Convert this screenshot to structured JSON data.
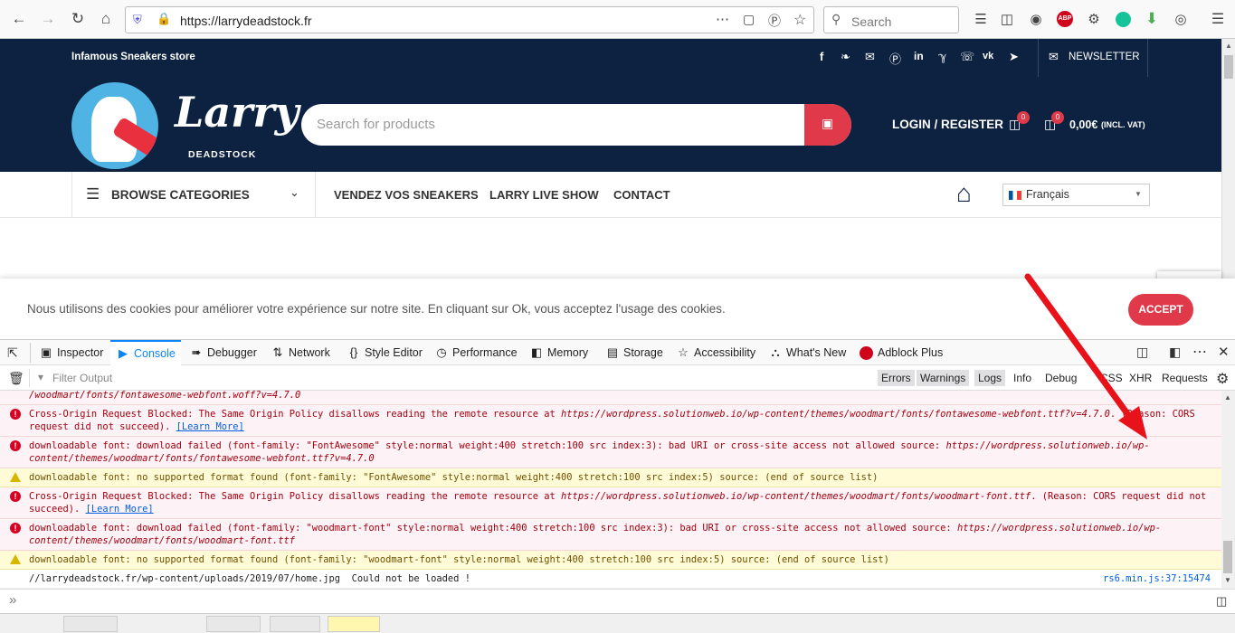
{
  "browser": {
    "url": "https://larrydeadstock.fr",
    "search_placeholder": "Search",
    "abp_badge": "ABP"
  },
  "site": {
    "tagline": "Infamous Sneakers store",
    "newsletter_label": "NEWSLETTER",
    "logo_script": "Larry",
    "logo_sub": "DEADSTOCK",
    "search_placeholder": "Search for products",
    "login_label": "LOGIN / REGISTER",
    "wishlist_count": "0",
    "cart_count": "0",
    "cart_total": "0,00€",
    "cart_vat": "(INCL. VAT)",
    "browse_label": "BROWSE CATEGORIES",
    "nav_items": [
      {
        "label": "VENDEZ VOS SNEAKERS"
      },
      {
        "label": "LARRY LIVE SHOW"
      },
      {
        "label": "CONTACT"
      }
    ],
    "language": "Français",
    "cookie_text": "Nous utilisons des cookies pour améliorer votre expérience sur notre site. En cliquant sur Ok, vous acceptez l'usage des cookies.",
    "accept_label": "ACCEPT"
  },
  "devtools": {
    "tabs": [
      {
        "label": "Inspector",
        "icon": "inspector-icon"
      },
      {
        "label": "Console",
        "icon": "console-icon"
      },
      {
        "label": "Debugger",
        "icon": "debugger-icon"
      },
      {
        "label": "Network",
        "icon": "network-icon"
      },
      {
        "label": "Style Editor",
        "icon": "style-editor-icon"
      },
      {
        "label": "Performance",
        "icon": "performance-icon"
      },
      {
        "label": "Memory",
        "icon": "memory-icon"
      },
      {
        "label": "Storage",
        "icon": "storage-icon"
      },
      {
        "label": "Accessibility",
        "icon": "accessibility-icon"
      },
      {
        "label": "What's New",
        "icon": "whats-new-icon"
      },
      {
        "label": "Adblock Plus",
        "icon": "abp-icon"
      }
    ],
    "filter_placeholder": "Filter Output",
    "filters": [
      {
        "label": "Errors",
        "on": true
      },
      {
        "label": "Warnings",
        "on": true
      },
      {
        "label": "Logs",
        "on": true
      },
      {
        "label": "Info",
        "on": false
      },
      {
        "label": "Debug",
        "on": false
      },
      {
        "label": "CSS",
        "on": false
      },
      {
        "label": "XHR",
        "on": false
      },
      {
        "label": "Requests",
        "on": false
      }
    ],
    "messages": [
      {
        "type": "err",
        "noicon": true,
        "text": "",
        "url": "/woodmart/fonts/fontawesome-webfont.woff?v=4.7.0",
        "after": "",
        "learn": ""
      },
      {
        "type": "err",
        "text": "Cross-Origin Request Blocked: The Same Origin Policy disallows reading the remote resource at ",
        "url": "https://wordpress.solutionweb.io/wp-content/themes/woodmart/fonts/fontawesome-webfont.ttf?v=4.7.0",
        "after": ". (Reason: CORS request did not succeed). ",
        "learn": "[Learn More]"
      },
      {
        "type": "err",
        "text": "downloadable font: download failed (font-family: \"FontAwesome\" style:normal weight:400 stretch:100 src index:3): bad URI or cross-site access not allowed source: ",
        "url": "https://wordpress.solutionweb.io/wp-content/themes/woodmart/fonts/fontawesome-webfont.ttf?v=4.7.0",
        "after": "",
        "learn": ""
      },
      {
        "type": "warn",
        "text": "downloadable font: no supported format found (font-family: \"FontAwesome\" style:normal weight:400 stretch:100 src index:5) source: (end of source list)",
        "url": "",
        "after": "",
        "learn": ""
      },
      {
        "type": "err",
        "text": "Cross-Origin Request Blocked: The Same Origin Policy disallows reading the remote resource at ",
        "url": "https://wordpress.solutionweb.io/wp-content/themes/woodmart/fonts/woodmart-font.ttf",
        "after": ". (Reason: CORS request did not succeed). ",
        "learn": "[Learn More]"
      },
      {
        "type": "err",
        "text": "downloadable font: download failed (font-family: \"woodmart-font\" style:normal weight:400 stretch:100 src index:3): bad URI or cross-site access not allowed source: ",
        "url": "https://wordpress.solutionweb.io/wp-content/themes/woodmart/fonts/woodmart-font.ttf",
        "after": "",
        "learn": ""
      },
      {
        "type": "warn",
        "text": "downloadable font: no supported format found (font-family: \"woodmart-font\" style:normal weight:400 stretch:100 src index:5) source: (end of source list)",
        "url": "",
        "after": "",
        "learn": ""
      },
      {
        "type": "log",
        "text": "//larrydeadstock.fr/wp-content/uploads/2019/07/home.jpg  Could not be loaded !",
        "url": "",
        "after": "",
        "learn": "",
        "source": "rs6.min.js:37:15474"
      }
    ],
    "prompt": "»"
  },
  "colors": {
    "site_navy": "#0d2240",
    "accent_red": "#e03a4a",
    "arrow_red": "#e8131a"
  }
}
